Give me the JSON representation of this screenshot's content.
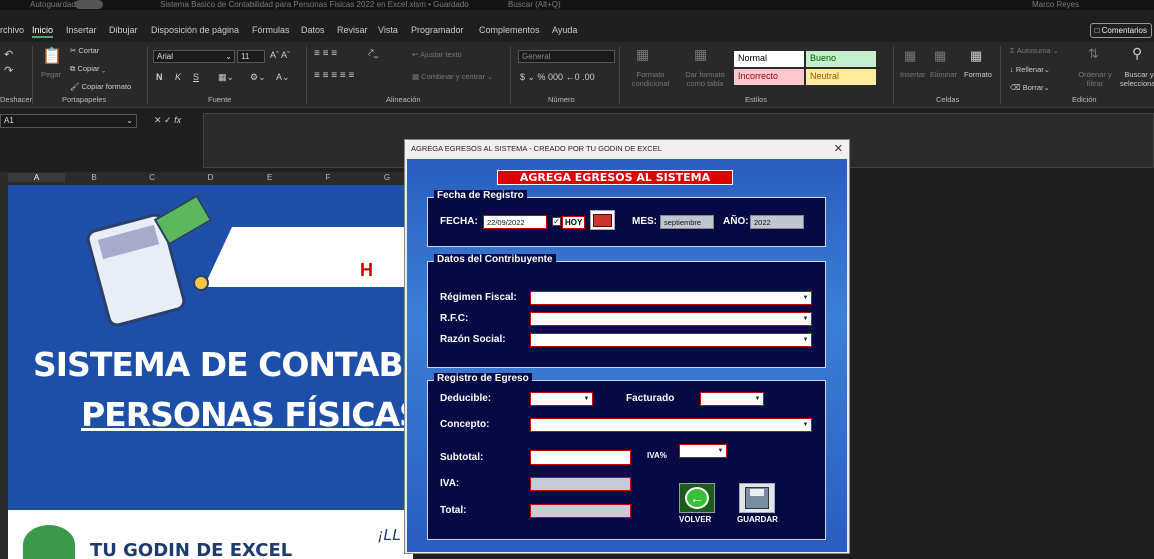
{
  "titlebar": {
    "autosave": "Autoguardado",
    "doc_title": "Sistema Basico de Contabilidad para Personas Fisicas 2022 en Excel.xlsm • Guardado",
    "search": "Buscar (Alt+Q)",
    "user": "Marco Reyes"
  },
  "tabs": [
    "rchivo",
    "Inicio",
    "Insertar",
    "Dibujar",
    "Disposición de página",
    "Fórmulas",
    "Datos",
    "Revisar",
    "Vista",
    "Programador",
    "Complementos",
    "Ayuda"
  ],
  "comments_button": "Comentarios",
  "ribbon": {
    "clipboard": {
      "paste": "Pegar",
      "cut": "Cortar",
      "copy": "Copiar",
      "format_painter": "Copiar formato",
      "group": "Portapapeles"
    },
    "undo_group": "Deshacer",
    "font": {
      "name": "Arial",
      "size": "11",
      "group": "Fuente",
      "bold": "N",
      "italic": "K",
      "underline": "S"
    },
    "alignment": {
      "wrap": "Ajustar texto",
      "merge": "Combinar y centrar",
      "group": "Alineación"
    },
    "number": {
      "format": "General",
      "group": "Número"
    },
    "styles": {
      "cond": "Formato condicional",
      "table": "Dar formato como tabla",
      "normal": "Normal",
      "bueno": "Bueno",
      "incorrecto": "Incorrecto",
      "neutral": "Neutral",
      "group": "Estilos"
    },
    "cells": {
      "insert": "Insertar",
      "delete": "Eliminar",
      "format": "Formato",
      "group": "Celdas"
    },
    "editing": {
      "autosum": "Autosuma",
      "fill": "Rellenar",
      "clear": "Borrar",
      "sort": "Ordenar y filtrar",
      "find": "Buscar y seleccionar",
      "group": "Edición"
    }
  },
  "namebox": "A1",
  "columns": [
    "A",
    "B",
    "C",
    "D",
    "E",
    "F",
    "G"
  ],
  "sheet": {
    "title1": "SISTEMA DE CONTABILID",
    "title2": "PERSONAS FÍSICAS E",
    "logo_text": "TU GODIN DE EXCEL",
    "partial_h": "H",
    "partial_l": "¡LL"
  },
  "dialog": {
    "title": "AGREGA EGRESOS AL SISTEMA - CREADO POR TU GODIN DE EXCEL",
    "header": "AGREGA EGRESOS AL SISTEMA",
    "fecha_registro": {
      "legend": "Fecha de Registro",
      "fecha_label": "FECHA:",
      "fecha_value": "22/09/2022",
      "hoy_label": "HOY",
      "hoy_checked": true,
      "mes_label": "MES:",
      "mes_value": "septiembre",
      "anio_label": "AÑO:",
      "anio_value": "2022"
    },
    "contribuyente": {
      "legend": "Datos del Contribuyente",
      "regimen_label": "Régimen Fiscal:",
      "rfc_label": "R.F.C:",
      "razon_label": "Razón Social:"
    },
    "egreso": {
      "legend": "Registro de Egreso",
      "deducible_label": "Deducible:",
      "facturado_label": "Facturado",
      "concepto_label": "Concepto:",
      "subtotal_label": "Subtotal:",
      "iva_pct_label": "IVA%",
      "iva_label": "IVA:",
      "total_label": "Total:"
    },
    "buttons": {
      "volver": "VOLVER",
      "guardar": "GUARDAR"
    }
  }
}
